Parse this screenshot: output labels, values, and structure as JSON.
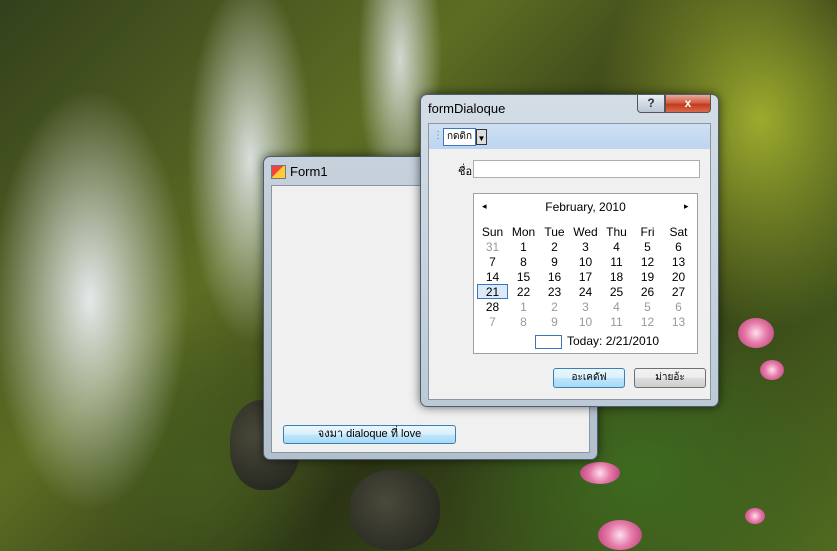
{
  "form1": {
    "title": "Form1",
    "button_label": "จงมา dialoque ที่ love"
  },
  "dialog": {
    "title": "formDialoque",
    "help_label": "?",
    "close_label": "x",
    "toolstrip_button": "กดดิก",
    "name_label": "ชื่อ",
    "name_value": "",
    "ok_label": "อะเคดัฟ",
    "cancel_label": "ม่ายอ้ะ"
  },
  "calendar": {
    "month_label": "February, 2010",
    "prev": "◂",
    "next": "▸",
    "weekdays": [
      "Sun",
      "Mon",
      "Tue",
      "Wed",
      "Thu",
      "Fri",
      "Sat"
    ],
    "weeks": [
      [
        "31",
        "1",
        "2",
        "3",
        "4",
        "5",
        "6"
      ],
      [
        "7",
        "8",
        "9",
        "10",
        "11",
        "12",
        "13"
      ],
      [
        "14",
        "15",
        "16",
        "17",
        "18",
        "19",
        "20"
      ],
      [
        "21",
        "22",
        "23",
        "24",
        "25",
        "26",
        "27"
      ],
      [
        "28",
        "1",
        "2",
        "3",
        "4",
        "5",
        "6"
      ],
      [
        "7",
        "8",
        "9",
        "10",
        "11",
        "12",
        "13"
      ]
    ],
    "selected_day": "21",
    "today_label": "Today: 2/21/2010"
  }
}
